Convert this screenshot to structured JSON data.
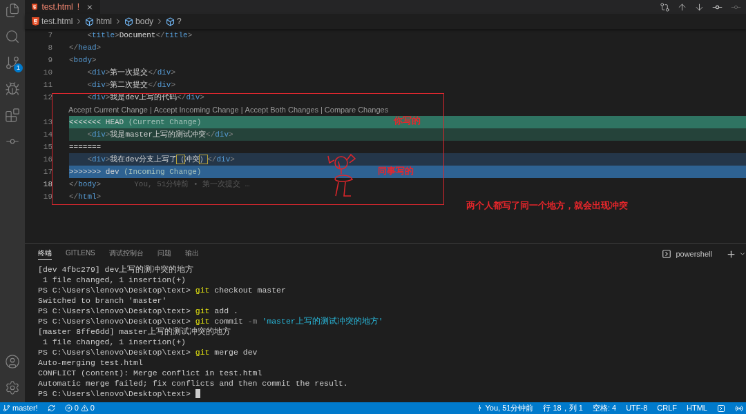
{
  "activity_bar": {
    "source_control_badge": "1"
  },
  "tab": {
    "title": "test.html",
    "problem_mark": "!",
    "selected": true
  },
  "breadcrumbs": [
    {
      "kind": "file",
      "label": "test.html"
    },
    {
      "kind": "symbol",
      "label": "html"
    },
    {
      "kind": "symbol",
      "label": "body"
    },
    {
      "kind": "symbol",
      "label": "?"
    }
  ],
  "editor": {
    "lines": [
      {
        "number": "7",
        "kind": "code",
        "active": false,
        "segments": [
          {
            "kind": "p",
            "s": "    <"
          },
          {
            "kind": "tag",
            "s": "title"
          },
          {
            "kind": "p",
            "s": ">"
          },
          {
            "kind": "text",
            "s": "Document"
          },
          {
            "kind": "p",
            "s": "</"
          },
          {
            "kind": "tag",
            "s": "title"
          },
          {
            "kind": "p",
            "s": ">"
          }
        ]
      },
      {
        "number": "8",
        "kind": "code",
        "active": false,
        "segments": [
          {
            "kind": "p",
            "s": "</"
          },
          {
            "kind": "tag",
            "s": "head"
          },
          {
            "kind": "p",
            "s": ">"
          }
        ]
      },
      {
        "number": "9",
        "kind": "code",
        "active": false,
        "segments": [
          {
            "kind": "p",
            "s": "<"
          },
          {
            "kind": "tag",
            "s": "body"
          },
          {
            "kind": "p",
            "s": ">"
          }
        ]
      },
      {
        "number": "10",
        "kind": "code",
        "active": false,
        "segments": [
          {
            "kind": "p",
            "s": "    <"
          },
          {
            "kind": "tag",
            "s": "div"
          },
          {
            "kind": "p",
            "s": ">"
          },
          {
            "kind": "text",
            "s": "第一次提交"
          },
          {
            "kind": "p",
            "s": "</"
          },
          {
            "kind": "tag",
            "s": "div"
          },
          {
            "kind": "p",
            "s": ">"
          }
        ]
      },
      {
        "number": "11",
        "kind": "code",
        "active": false,
        "segments": [
          {
            "kind": "p",
            "s": "    <"
          },
          {
            "kind": "tag",
            "s": "div"
          },
          {
            "kind": "p",
            "s": ">"
          },
          {
            "kind": "text",
            "s": "第二次提交"
          },
          {
            "kind": "p",
            "s": "</"
          },
          {
            "kind": "tag",
            "s": "div"
          },
          {
            "kind": "p",
            "s": ">"
          }
        ]
      },
      {
        "number": "12",
        "kind": "code",
        "active": false,
        "segments": [
          {
            "kind": "p",
            "s": "    <"
          },
          {
            "kind": "tag",
            "s": "div"
          },
          {
            "kind": "p",
            "s": ">"
          },
          {
            "kind": "text",
            "s": "我是dev上写的代码"
          },
          {
            "kind": "p",
            "s": "</"
          },
          {
            "kind": "tag",
            "s": "div"
          },
          {
            "kind": "p",
            "s": ">"
          }
        ],
        "codelens": {
          "separator": "|",
          "actions": [
            "Accept Current Change",
            "Accept Incoming Change",
            "Accept Both Changes",
            "Compare Changes"
          ]
        }
      },
      {
        "number": "13",
        "kind": "current_marker",
        "active": false,
        "segments": [
          {
            "kind": "text",
            "s": "<<<<<<< HEAD "
          },
          {
            "kind": "note",
            "s": "(Current Change)"
          }
        ]
      },
      {
        "number": "14",
        "kind": "current",
        "active": false,
        "segments": [
          {
            "kind": "p",
            "s": "    <"
          },
          {
            "kind": "tag",
            "s": "div"
          },
          {
            "kind": "p",
            "s": ">"
          },
          {
            "kind": "text",
            "s": "我是master上写的测试冲突"
          },
          {
            "kind": "p",
            "s": "</"
          },
          {
            "kind": "tag",
            "s": "div"
          },
          {
            "kind": "p",
            "s": ">"
          }
        ]
      },
      {
        "number": "15",
        "kind": "separator",
        "active": false,
        "segments": [
          {
            "kind": "text",
            "s": "======="
          }
        ]
      },
      {
        "number": "16",
        "kind": "incoming",
        "active": false,
        "segments": [
          {
            "kind": "p",
            "s": "    <"
          },
          {
            "kind": "tag",
            "s": "div"
          },
          {
            "kind": "p",
            "s": ">"
          },
          {
            "kind": "text",
            "s": "我在dev分支上写了"
          },
          {
            "kind": "match",
            "s": "（"
          },
          {
            "kind": "text",
            "s": "冲突"
          },
          {
            "kind": "match",
            "s": "）"
          },
          {
            "kind": "p",
            "s": "</"
          },
          {
            "kind": "tag",
            "s": "div"
          },
          {
            "kind": "p",
            "s": ">"
          }
        ]
      },
      {
        "number": "17",
        "kind": "incoming_marker",
        "active": false,
        "segments": [
          {
            "kind": "text",
            "s": ">>>>>>> dev "
          },
          {
            "kind": "note",
            "s": "(Incoming Change)"
          }
        ]
      },
      {
        "number": "18",
        "kind": "code",
        "active": true,
        "blame": "You, 51分钟前 • 第一次提交 …",
        "segments": [
          {
            "kind": "p",
            "s": "</"
          },
          {
            "kind": "tag",
            "s": "body"
          },
          {
            "kind": "p",
            "s": ">"
          }
        ]
      },
      {
        "number": "19",
        "kind": "code",
        "active": false,
        "segments": [
          {
            "kind": "p",
            "s": "</"
          },
          {
            "kind": "tag",
            "s": "html"
          },
          {
            "kind": "p",
            "s": ">"
          }
        ]
      }
    ]
  },
  "annotations": {
    "current_label": "你写的",
    "incoming_label": "同事写的",
    "note": "两个人都写了同一个地方，就会出现冲突"
  },
  "panel": {
    "tabs": [
      {
        "label": "终端",
        "selected": true
      },
      {
        "label": "GITLENS",
        "selected": false
      },
      {
        "label": "调试控制台",
        "selected": false
      },
      {
        "label": "问题",
        "selected": false
      },
      {
        "label": "输出",
        "selected": false
      }
    ],
    "shell": "powershell",
    "terminal_lines": [
      [
        {
          "kind": "out",
          "s": "[dev 4fbc279] dev上写的测冲突的地方"
        }
      ],
      [
        {
          "kind": "out",
          "s": " 1 file changed, 1 insertion(+)"
        }
      ],
      [
        {
          "kind": "out",
          "s": "PS C:\\Users\\lenovo\\Desktop\\text> "
        },
        {
          "kind": "cmd",
          "s": "git"
        },
        {
          "kind": "out",
          "s": " checkout master"
        }
      ],
      [
        {
          "kind": "out",
          "s": "Switched to branch 'master'"
        }
      ],
      [
        {
          "kind": "out",
          "s": "PS C:\\Users\\lenovo\\Desktop\\text> "
        },
        {
          "kind": "cmd",
          "s": "git"
        },
        {
          "kind": "out",
          "s": " add ."
        }
      ],
      [
        {
          "kind": "out",
          "s": "PS C:\\Users\\lenovo\\Desktop\\text> "
        },
        {
          "kind": "cmd",
          "s": "git"
        },
        {
          "kind": "out",
          "s": " commit "
        },
        {
          "kind": "flag",
          "s": "-m"
        },
        {
          "kind": "str",
          "s": " 'master上写的测试冲突的地方'"
        }
      ],
      [
        {
          "kind": "out",
          "s": "[master 8ffe6dd] master上写的测试冲突的地方"
        }
      ],
      [
        {
          "kind": "out",
          "s": " 1 file changed, 1 insertion(+)"
        }
      ],
      [
        {
          "kind": "out",
          "s": "PS C:\\Users\\lenovo\\Desktop\\text> "
        },
        {
          "kind": "cmd",
          "s": "git"
        },
        {
          "kind": "out",
          "s": " merge dev"
        }
      ],
      [
        {
          "kind": "out",
          "s": "Auto-merging test.html"
        }
      ],
      [
        {
          "kind": "out",
          "s": "CONFLICT (content): Merge conflict in test.html"
        }
      ],
      [
        {
          "kind": "out",
          "s": "Automatic merge failed; fix conflicts and then commit the result."
        }
      ],
      [
        {
          "kind": "out",
          "s": "PS C:\\Users\\lenovo\\Desktop\\text> "
        }
      ]
    ],
    "cursor_visible": true
  },
  "status_bar": {
    "branch": "master!",
    "errors": "0",
    "warnings": "0",
    "blame": "You, 51分钟前",
    "position": "行 18，列 1",
    "indent": "空格: 4",
    "encoding": "UTF-8",
    "eol": "CRLF",
    "language": "HTML"
  }
}
